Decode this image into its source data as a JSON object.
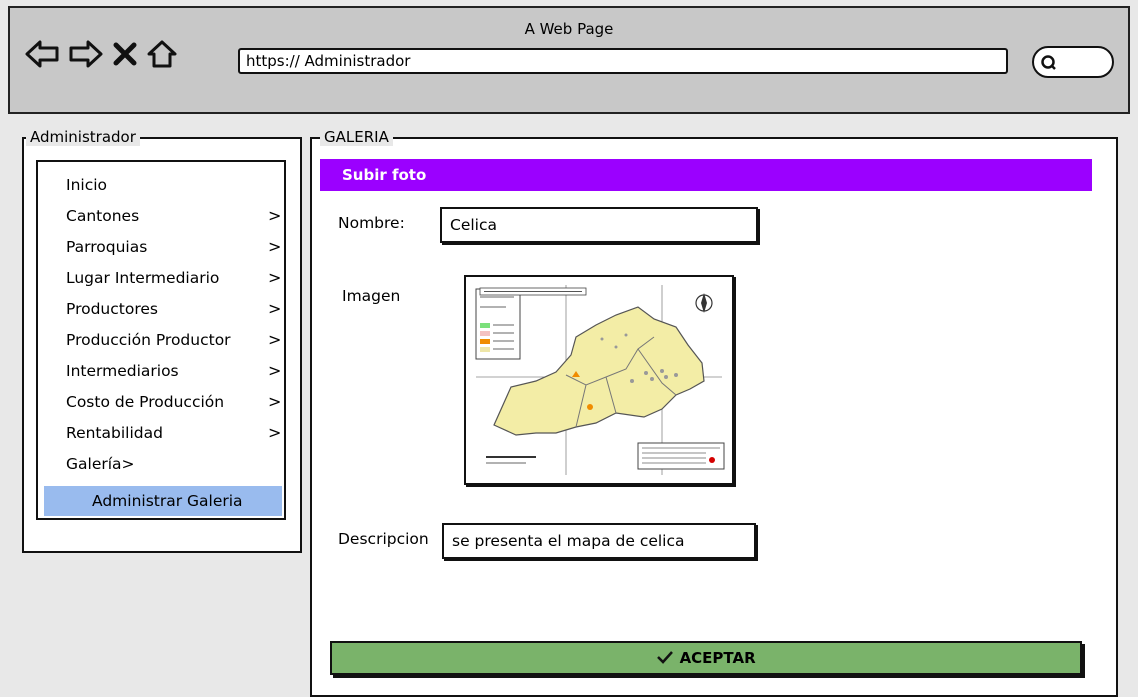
{
  "window": {
    "title": "A Web Page"
  },
  "toolbar": {
    "url": "https:// Administrador"
  },
  "sidebar": {
    "legend": "Administrador",
    "items": [
      {
        "label": "Inicio",
        "chevron": ""
      },
      {
        "label": "Cantones",
        "chevron": ">"
      },
      {
        "label": "Parroquias",
        "chevron": ">"
      },
      {
        "label": "Lugar Intermediario",
        "chevron": ">"
      },
      {
        "label": "Productores",
        "chevron": ">"
      },
      {
        "label": "Producción Productor",
        "chevron": ">"
      },
      {
        "label": "Intermediarios",
        "chevron": ">"
      },
      {
        "label": "Costo de Producción",
        "chevron": ">"
      },
      {
        "label": "Rentabilidad",
        "chevron": ">"
      },
      {
        "label": "Galería>",
        "chevron": ""
      },
      {
        "label": "Administrar Galeria",
        "chevron": ""
      }
    ],
    "selected_color": "#99bbee"
  },
  "main": {
    "legend": "GALERIA",
    "header": "Subir foto",
    "header_color": "#9b00ff",
    "nombre_label": "Nombre:",
    "nombre_value": "Celica",
    "imagen_label": "Imagen",
    "descripcion_label": "Descripcion",
    "descripcion_value": "se presenta el mapa de celica",
    "accept_label": "ACEPTAR",
    "accept_color": "#7ab36a"
  },
  "icons": [
    "back-arrow-icon",
    "forward-arrow-icon",
    "close-icon",
    "home-icon",
    "search-icon",
    "check-icon"
  ]
}
